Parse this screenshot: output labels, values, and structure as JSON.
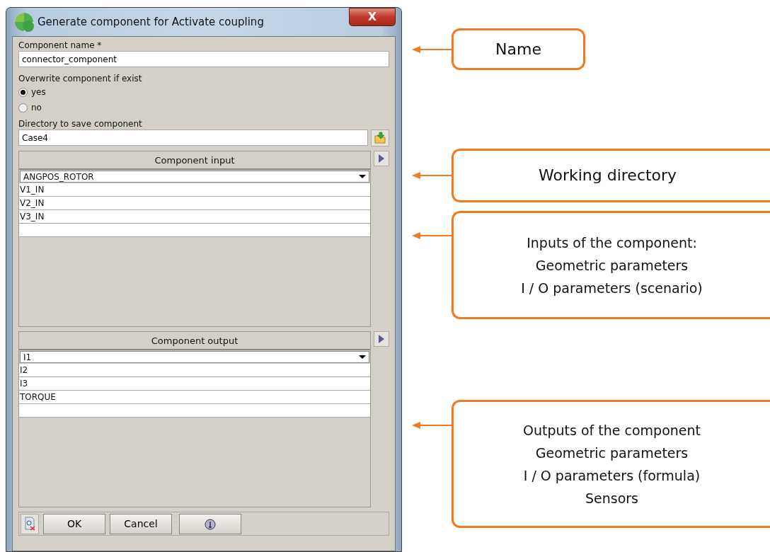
{
  "window": {
    "title": "Generate component for Activate coupling",
    "close": "X"
  },
  "name_field": {
    "label": "Component name *",
    "value": "connector_component"
  },
  "overwrite": {
    "label": "Overwrite component if exist",
    "options": [
      {
        "label": "yes",
        "selected": true
      },
      {
        "label": "no",
        "selected": false
      }
    ]
  },
  "directory_field": {
    "label": "Directory to save component",
    "value": "Case4"
  },
  "tables": [
    {
      "header": "Component input",
      "dropdown": "ANGPOS_ROTOR",
      "rows": [
        "V1_IN",
        "V2_IN",
        "V3_IN"
      ]
    },
    {
      "header": "Component output",
      "dropdown": "I1",
      "rows": [
        "I2",
        "I3",
        "TORQUE"
      ]
    }
  ],
  "buttons": [
    {
      "label": "OK"
    },
    {
      "label": "Cancel"
    }
  ],
  "callouts": [
    {
      "lines": [
        "Name"
      ]
    },
    {
      "lines": [
        "Working directory"
      ]
    },
    {
      "lines": [
        "Inputs  of the component:",
        "Geometric parameters",
        "I / O parameters (scenario)"
      ]
    },
    {
      "lines": [
        "Outputs of the component",
        "Geometric parameters",
        "I / O parameters (formula)",
        "Sensors"
      ]
    }
  ]
}
